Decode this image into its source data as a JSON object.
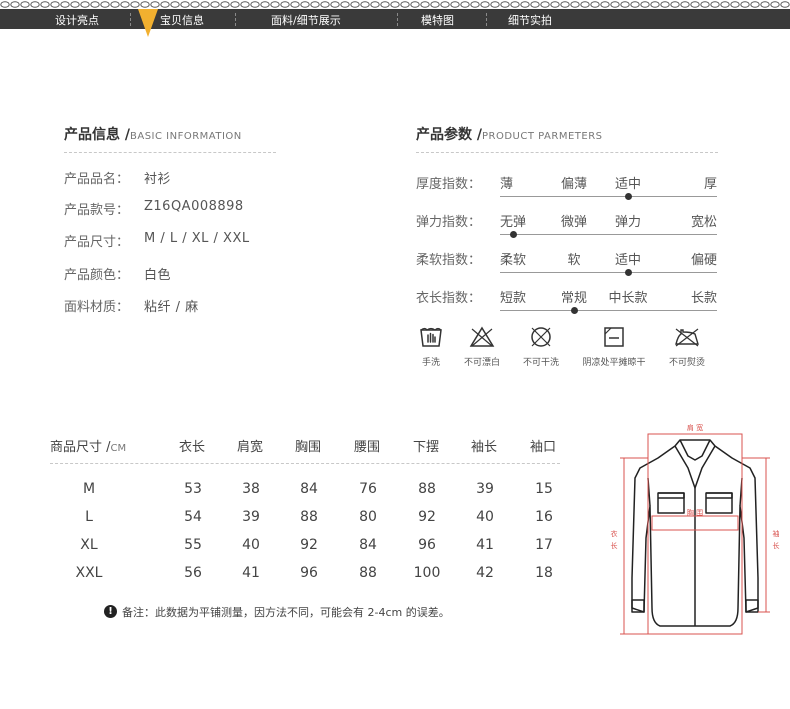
{
  "nav": {
    "items": [
      "设计亮点",
      "宝贝信息",
      "面料/细节展示",
      "模特图",
      "细节实拍"
    ],
    "active_index": 1
  },
  "basic_info": {
    "title": "产品信息 /",
    "title_en": "BASIC INFORMATION",
    "rows": [
      {
        "label": "产品品名：",
        "value": "衬衫"
      },
      {
        "label": "产品款号：",
        "value": "Z16QA008898"
      },
      {
        "label": "产品尺寸：",
        "value": "M / L / XL / XXL"
      },
      {
        "label": "产品颜色：",
        "value": "白色"
      },
      {
        "label": "面料材质：",
        "value": "粘纤 / 麻"
      }
    ]
  },
  "product_params": {
    "title": "产品参数 /",
    "title_en": "PRODUCT PARMETERS",
    "rows": [
      {
        "label": "厚度指数：",
        "options": [
          "薄",
          "偏薄",
          "适中",
          "厚"
        ],
        "selected_index": 2
      },
      {
        "label": "弹力指数：",
        "options": [
          "无弹",
          "微弹",
          "弹力",
          "宽松"
        ],
        "selected_index": 0
      },
      {
        "label": "柔软指数：",
        "options": [
          "柔软",
          "软",
          "适中",
          "偏硬"
        ],
        "selected_index": 2
      },
      {
        "label": "衣长指数：",
        "options": [
          "短款",
          "常规",
          "中长款",
          "长款"
        ],
        "selected_index": 1
      }
    ]
  },
  "care": [
    {
      "icon": "hand-wash-icon",
      "label": "手洗"
    },
    {
      "icon": "no-bleach-icon",
      "label": "不可漂白"
    },
    {
      "icon": "no-dry-clean-icon",
      "label": "不可干洗"
    },
    {
      "icon": "dry-flat-shade-icon",
      "label": "阴凉处平摊晾干"
    },
    {
      "icon": "no-iron-icon",
      "label": "不可熨烫"
    }
  ],
  "size_table": {
    "header_label": "商品尺寸 /",
    "header_unit": "CM",
    "columns": [
      "衣长",
      "肩宽",
      "胸围",
      "腰围",
      "下摆",
      "袖长",
      "袖口"
    ],
    "rows": [
      {
        "size": "M",
        "values": [
          "53",
          "38",
          "84",
          "76",
          "88",
          "39",
          "15"
        ]
      },
      {
        "size": "L",
        "values": [
          "54",
          "39",
          "88",
          "80",
          "92",
          "40",
          "16"
        ]
      },
      {
        "size": "XL",
        "values": [
          "55",
          "40",
          "92",
          "84",
          "96",
          "41",
          "17"
        ]
      },
      {
        "size": "XXL",
        "values": [
          "56",
          "41",
          "96",
          "88",
          "100",
          "42",
          "18"
        ]
      }
    ]
  },
  "note": {
    "icon_text": "!",
    "text": "备注：此数据为平铺测量，因方法不同，可能会有 2-4cm 的误差。"
  },
  "diagram": {
    "shoulder_label": "肩 宽",
    "chest_label": "胸 围",
    "length_label_1": "衣",
    "length_label_2": "长",
    "sleeve_label_1": "袖",
    "sleeve_label_2": "长",
    "measure_color": "#d9534f"
  },
  "colors": {
    "nav_bg": "#3a3a3a",
    "nav_pointer": "#f2b02f",
    "dot": "#333333"
  }
}
